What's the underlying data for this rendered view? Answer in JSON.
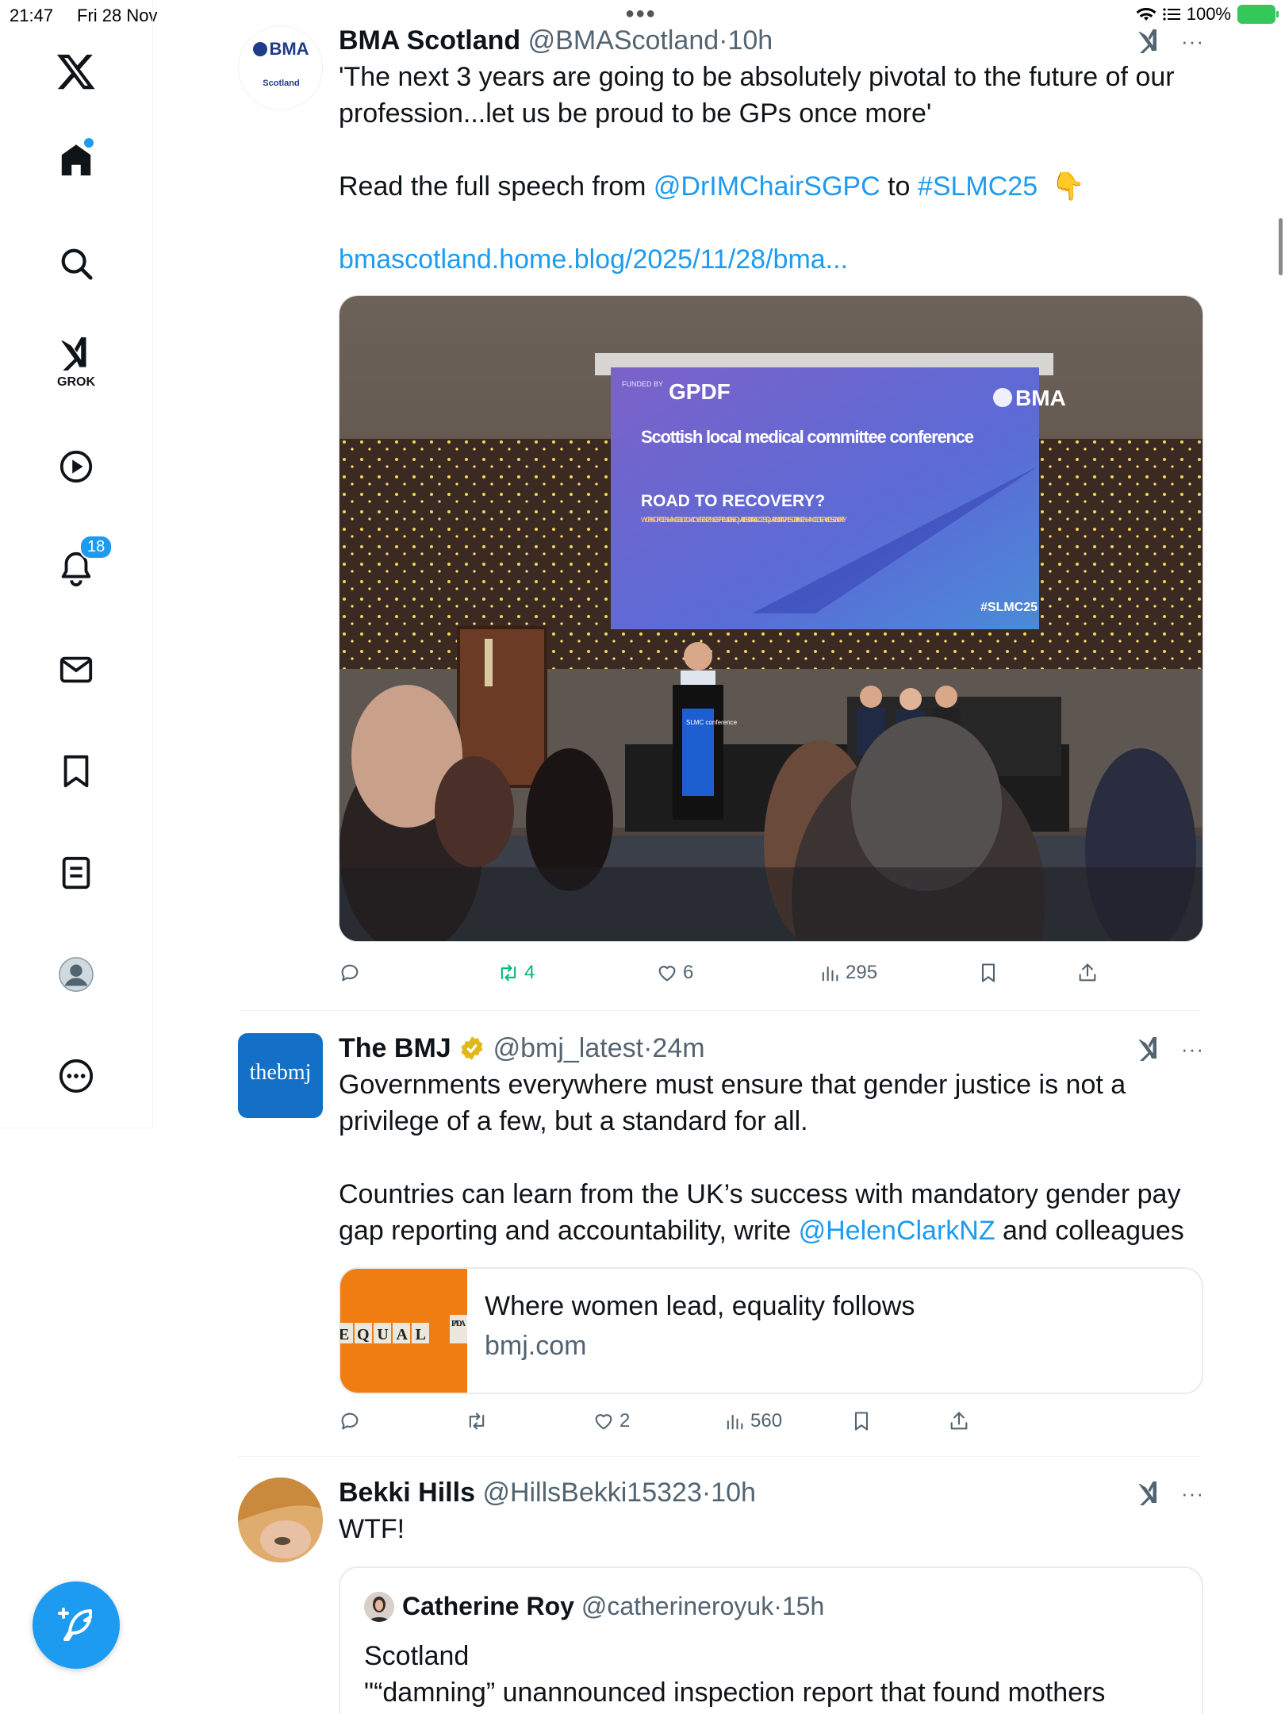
{
  "status": {
    "time": "21:47",
    "date": "Fri 28 Nov",
    "battery": "100%"
  },
  "sidebar": {
    "items": [
      {
        "icon": "x-logo-icon"
      },
      {
        "icon": "home-icon"
      },
      {
        "icon": "search-icon"
      },
      {
        "icon": "grok-icon",
        "label": "GROK"
      },
      {
        "icon": "video-icon"
      },
      {
        "icon": "notifications-icon",
        "badge": "18"
      },
      {
        "icon": "messages-icon"
      },
      {
        "icon": "bookmarks-icon"
      },
      {
        "icon": "lists-icon"
      },
      {
        "icon": "profile-icon"
      },
      {
        "icon": "more-icon"
      }
    ],
    "compose_icon": "compose-icon"
  },
  "tweets": [
    {
      "name": "BMA Scotland",
      "handle": "@BMAScotland",
      "time": "10h",
      "avatar_text": "BMA",
      "avatar_subtext": "Scotland",
      "text1": "'The next 3 years are going to be absolutely pivotal to the future of our profession...let us be proud to be GPs once more'",
      "text2_prefix": "Read the full speech from ",
      "mention": "@DrIMChairSGPC",
      "text2_mid": " to ",
      "hashtag": "#SLMC25",
      "emoji": "👇",
      "url": "bmascotland.home.blog/2025/11/28/bma...",
      "screen": {
        "funded_by": "FUNDED BY",
        "gpdf": "GPDF",
        "bma": "BMA",
        "title": "Scottish local medical committee conference",
        "subtitle": "ROAD TO RECOVERY?",
        "tags": "WORKFORCE  ENHANCED LOCUM COVER  EXPENSES  PREMISES  INEQUALITIES  DIGITAL  & ACCESS  QUALITY  DIGITAL PRESCRIBING  ENHANCED SERVICES  SENIORITY",
        "hashtag": "#SLMC25",
        "podium": "SLMC conference"
      },
      "stats": {
        "replies": "",
        "retweets": "4",
        "likes": "6",
        "views": "295"
      }
    },
    {
      "name": "The BMJ",
      "handle": "@bmj_latest",
      "time": "24m",
      "avatar_text": "thebmj",
      "text1": "Governments everywhere must ensure that gender justice is not a privilege of a few, but a standard for all.",
      "text2_prefix": "Countries can learn from the UK’s success with mandatory gender pay gap reporting and accountability, write ",
      "mention": "@HelenClarkNZ",
      "text2_suffix": " and colleagues",
      "card": {
        "title": "Where women lead, equality follows",
        "domain": "bmj.com",
        "img_text": "EQUAL",
        "img_side": "PA DA"
      },
      "stats": {
        "replies": "",
        "retweets": "",
        "likes": "2",
        "views": "560"
      }
    },
    {
      "name": "Bekki Hills",
      "handle": "@HillsBekki15323",
      "time": "10h",
      "text1": "WTF!",
      "quote": {
        "name": "Catherine Roy",
        "handle": "@catherineroyuk",
        "time": "15h",
        "line1": "Scotland",
        "line2": "\"“damning” unannounced inspection report that found mothers"
      }
    }
  ],
  "sep": "·",
  "colors": {
    "accent": "#1d9bf0",
    "retweet_active": "#00ba7c",
    "verified": "#e2b719",
    "muted": "#536471"
  }
}
